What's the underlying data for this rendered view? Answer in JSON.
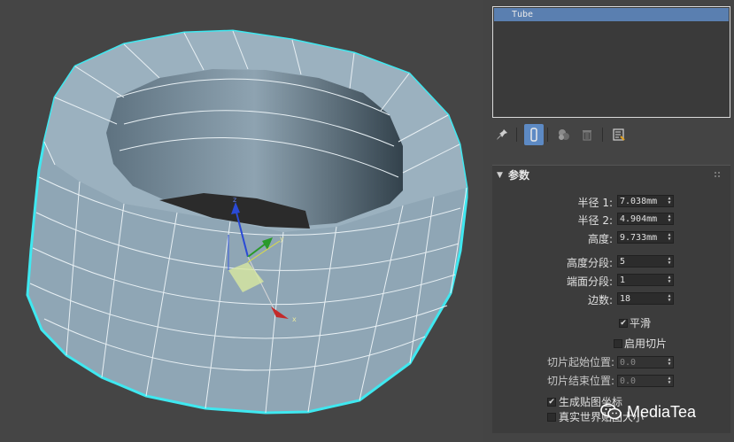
{
  "object_list": {
    "selected": "Tube"
  },
  "toolbar": {
    "icons": [
      "pin-stack-icon",
      "show-end-result-icon",
      "make-unique-icon",
      "remove-modifier-icon",
      "configure-modifier-sets-icon"
    ]
  },
  "rollout": {
    "title": "参数",
    "params": [
      {
        "label": "半径 1:",
        "value": "7.038mm"
      },
      {
        "label": "半径 2:",
        "value": "4.904mm"
      },
      {
        "label": "高度:",
        "value": "9.733mm"
      },
      {
        "label": "高度分段:",
        "value": "5"
      },
      {
        "label": "端面分段:",
        "value": "1"
      },
      {
        "label": "边数:",
        "value": "18"
      }
    ],
    "smooth": {
      "label": "平滑",
      "checked": true
    },
    "slice_on": {
      "label": "启用切片",
      "checked": false
    },
    "slice_from": {
      "label": "切片起始位置:",
      "value": "0.0"
    },
    "slice_to": {
      "label": "切片结束位置:",
      "value": "0.0"
    },
    "gen_map_coords": {
      "label": "生成贴图坐标",
      "checked": true
    },
    "real_world_map": {
      "label": "真实世界贴图大小",
      "checked": false
    }
  },
  "watermark": {
    "text": "MediaTea"
  },
  "colors": {
    "mesh_fill": "#8fa6b5",
    "mesh_edge": "#e8f0f4",
    "selection_outline": "#3fe8f0",
    "selected_row": "#5a7fb0",
    "gizmo_x": "#c42a2a",
    "gizmo_y": "#2a9a2a",
    "gizmo_z": "#2a4ad6"
  }
}
